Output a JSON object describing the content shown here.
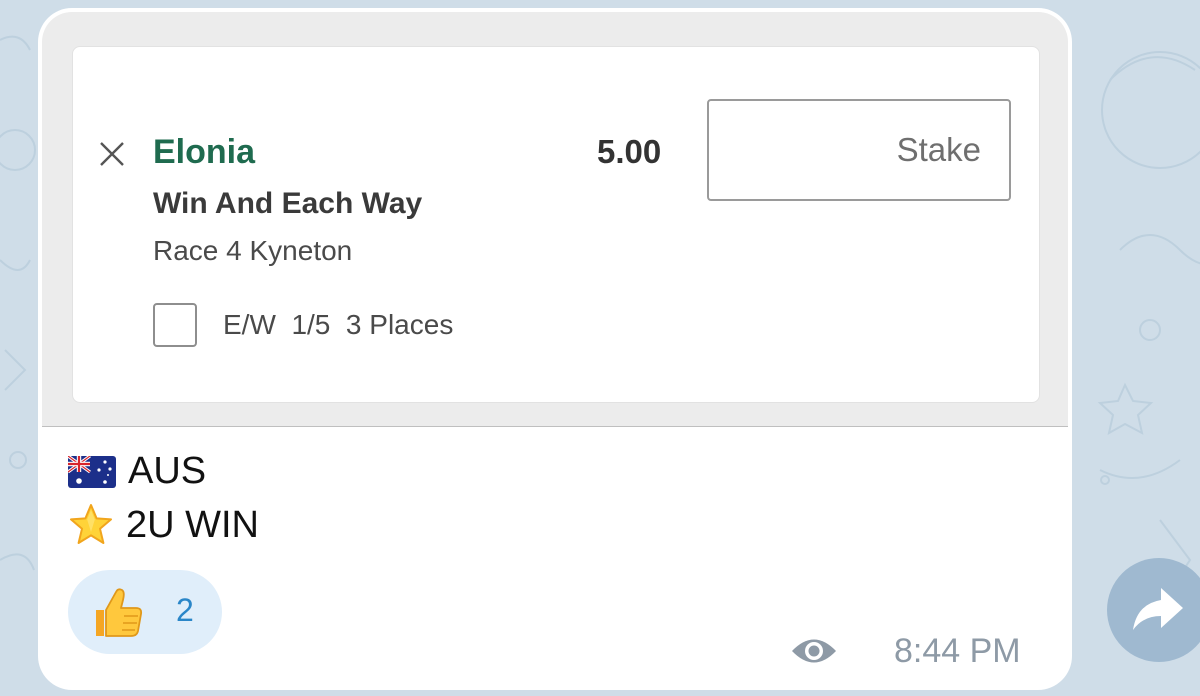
{
  "bet_slip": {
    "selection": "Elonia",
    "market": "Win And Each Way",
    "event": "Race 4 Kyneton",
    "odds": "5.00",
    "stake_placeholder": "Stake",
    "each_way_label": "E/W  1/5  3 Places",
    "each_way_checked": false
  },
  "message": {
    "line1_icon": "australia-flag",
    "line1_text": "AUS",
    "line2_icon": "star",
    "line2_text": "2U WIN"
  },
  "reaction": {
    "icon": "thumbs-up",
    "count": "2"
  },
  "meta": {
    "views_icon": "eye",
    "time": "8:44 PM"
  },
  "colors": {
    "chat_background": "#cfdde8",
    "selection_green": "#1f6b4f",
    "reaction_count_blue": "#2a86c8",
    "forward_button": "#9fb9d0"
  }
}
